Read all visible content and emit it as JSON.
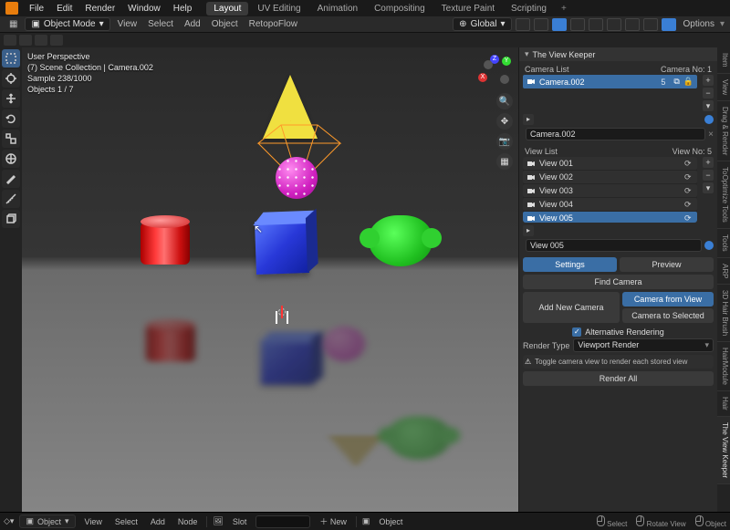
{
  "menu": {
    "items": [
      "File",
      "Edit",
      "Render",
      "Window",
      "Help"
    ]
  },
  "workspaces": {
    "tabs": [
      "Layout",
      "UV Editing",
      "Animation",
      "Compositing",
      "Texture Paint",
      "Scripting"
    ],
    "active": 0
  },
  "mode_bar": {
    "mode": "Object Mode",
    "items": [
      "View",
      "Select",
      "Add",
      "Object"
    ],
    "retopo": "RetopoFlow",
    "orientation": "Global",
    "options": "Options"
  },
  "viewport": {
    "info_line1": "User Perspective",
    "info_line2": "(7) Scene Collection | Camera.002",
    "info_line3": "Sample 238/1000",
    "info_line4": "Objects   1 / 7"
  },
  "panel": {
    "title": "The View Keeper",
    "camera_list_label": "Camera List",
    "camera_no_label": "Camera No:",
    "camera_no": "1",
    "cameras": [
      {
        "name": "Camera.002",
        "selected": true,
        "badge": "5"
      }
    ],
    "camera_field": "Camera.002",
    "view_list_label": "View List",
    "view_no_label": "View No:",
    "view_no": "5",
    "views": [
      {
        "name": "View 001"
      },
      {
        "name": "View 002"
      },
      {
        "name": "View 003"
      },
      {
        "name": "View 004"
      },
      {
        "name": "View 005",
        "selected": true
      }
    ],
    "view_field": "View 005",
    "btn_settings": "Settings",
    "btn_preview": "Preview",
    "btn_find_camera": "Find Camera",
    "btn_add_camera": "Add New Camera",
    "btn_cam_from_view": "Camera from View",
    "btn_cam_to_selected": "Camera to Selected",
    "alt_render_label": "Alternative Rendering",
    "render_type_label": "Render Type",
    "render_type_value": "Viewport Render",
    "warn_text": "Toggle camera view to render each stored view",
    "btn_render_all": "Render All",
    "tabs": [
      "Item",
      "View",
      "Drag & Render",
      "ToOptimize Tools",
      "Tools",
      "ARP",
      "3D Hair Brush",
      "HairModule",
      "Hair",
      "The View Keeper"
    ]
  },
  "bottom": {
    "mode": "Object",
    "items": [
      "View",
      "Select",
      "Add",
      "Node"
    ],
    "slot_label": "Slot",
    "slot_value": "",
    "new_label": "New",
    "object_label": "Object",
    "hint_select": "Select",
    "hint_rotate": "Rotate View",
    "hint_object": "Object"
  }
}
